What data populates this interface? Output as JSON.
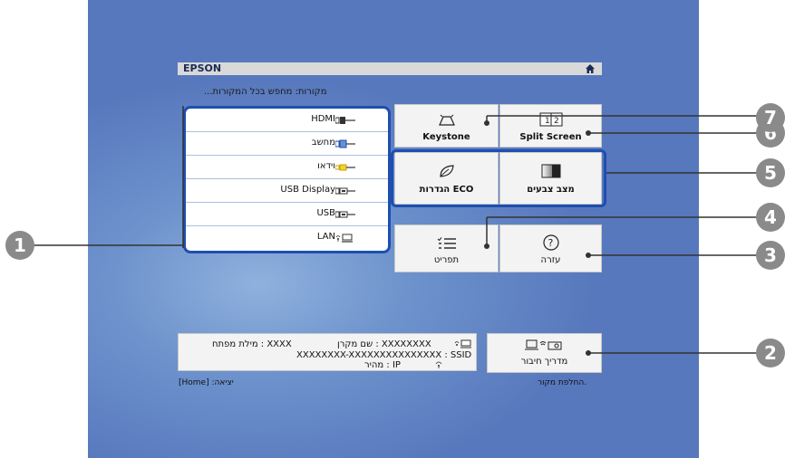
{
  "header": {
    "brand": "EPSON"
  },
  "source_line": "מקורות: מחפש בכל המקורות...",
  "sources": [
    {
      "label": "HDMI",
      "icon": "hdmi-port-icon"
    },
    {
      "label": "מחשב",
      "icon": "computer-port-icon"
    },
    {
      "label": "וידאו",
      "icon": "video-port-icon"
    },
    {
      "label": "USB Display",
      "icon": "usb-display-icon"
    },
    {
      "label": "USB",
      "icon": "usb-port-icon"
    },
    {
      "label": "LAN",
      "icon": "lan-icon"
    }
  ],
  "tiles": {
    "keystone": "Keystone",
    "split_screen": "Split Screen",
    "eco": "הגדרות ECO",
    "color_mode": "מצב צבעים",
    "menu": "תפריט",
    "help": "עזרה",
    "connection_guide": "מדריך חיבור"
  },
  "info": {
    "key_label": "מילת מפתח : XXXX",
    "projector_name": "שם מקרן : XXXXXXXX",
    "ssid": "XXXXXXXX-XXXXXXXXXXXXXXX : SSID",
    "ip": "מהיר : IP"
  },
  "footer": {
    "exit": "[Home] :יציאה",
    "switch_source": "החלפת מקור."
  },
  "callouts": [
    "1",
    "2",
    "3",
    "4",
    "5",
    "6",
    "7"
  ],
  "colors": {
    "selection": "#1d4fb0",
    "callout": "#8a8a8a",
    "screen": "#5878bd"
  }
}
